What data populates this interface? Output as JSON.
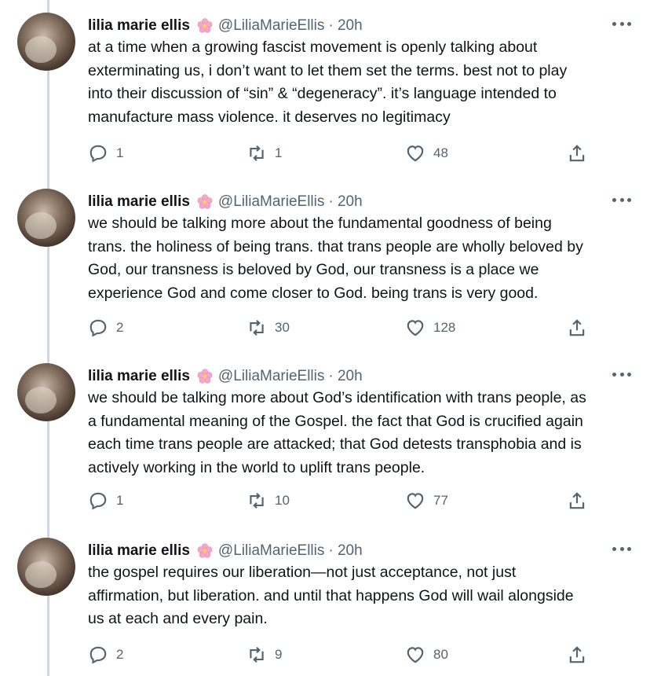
{
  "colors": {
    "text": "#0f1419",
    "secondary": "#536471",
    "thread_line": "#cfd9de",
    "flower": "#f4a7c9"
  },
  "tweets": [
    {
      "name": "lilia marie ellis",
      "badge_icon": "cherry-blossom-icon",
      "handle": "@LiliaMarieEllis",
      "time": "· 20h",
      "lines": [
        "at a time when a growing fascist movement is openly talking about",
        "exterminating us, i don’t want to let them set the terms. best not to play",
        "into their discussion of “sin” & “degeneracy”. it’s language intended to",
        "manufacture mass violence. it deserves no legitimacy"
      ],
      "replies": "1",
      "retweets": "1",
      "likes": "48"
    },
    {
      "name": "lilia marie ellis",
      "badge_icon": "cherry-blossom-icon",
      "handle": "@LiliaMarieEllis",
      "time": "· 20h",
      "lines": [
        "we should be talking more about the fundamental goodness of being",
        "trans. the holiness of being trans. that trans people are wholly beloved by",
        "God, our transness is beloved by God, our transness is a place we",
        "experience God and come closer to God. being trans is very good."
      ],
      "replies": "2",
      "retweets": "30",
      "likes": "128"
    },
    {
      "name": "lilia marie ellis",
      "badge_icon": "cherry-blossom-icon",
      "handle": "@LiliaMarieEllis",
      "time": "· 20h",
      "lines": [
        "we should be talking more about God’s identification with trans people, as",
        "a fundamental meaning of the Gospel. the fact that God is crucified again",
        "each time trans people are attacked; that God detests transphobia and is",
        "actively working in the world to uplift trans people."
      ],
      "replies": "1",
      "retweets": "10",
      "likes": "77"
    },
    {
      "name": "lilia marie ellis",
      "badge_icon": "cherry-blossom-icon",
      "handle": "@LiliaMarieEllis",
      "time": "· 20h",
      "lines": [
        "the gospel requires our liberation—not just acceptance, not just",
        "affirmation, but liberation. and until that happens God will wail alongside",
        "us at each and every pain."
      ],
      "replies": "2",
      "retweets": "9",
      "likes": "80"
    }
  ]
}
